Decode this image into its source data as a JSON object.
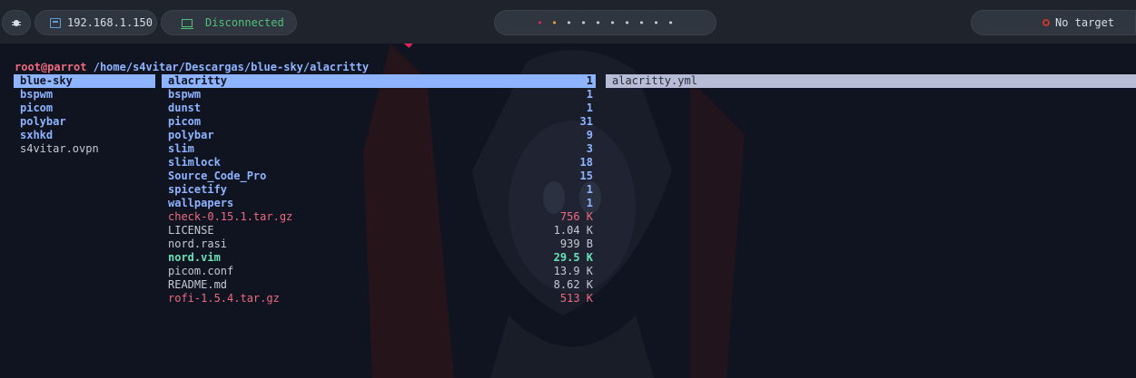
{
  "topbar": {
    "ip": "192.168.1.150",
    "vpn_status": "Disconnected",
    "workspaces": [
      "•",
      "•",
      "•",
      "•",
      "•",
      "•",
      "•",
      "•",
      "•",
      "•"
    ],
    "workspace_colors": [
      "#e0245e",
      "#f0a030",
      "#c8ccd4",
      "#c8ccd4",
      "#c8ccd4",
      "#c8ccd4",
      "#c8ccd4",
      "#c8ccd4",
      "#c8ccd4",
      "#c8ccd4"
    ],
    "target": "No target"
  },
  "ranger": {
    "path_user": "root@parrot",
    "path_dir": "/home/s4vitar/Descargas/blue-sky/alacritty",
    "parent": [
      {
        "name": "blue-sky",
        "type": "dir",
        "selected": true
      },
      {
        "name": "bspwm",
        "type": "dir"
      },
      {
        "name": "picom",
        "type": "dir"
      },
      {
        "name": "polybar",
        "type": "dir"
      },
      {
        "name": "sxhkd",
        "type": "dir"
      },
      {
        "name": "s4vitar.ovpn",
        "type": "file"
      }
    ],
    "current": [
      {
        "name": "alacritty",
        "size": "1",
        "type": "dir",
        "selected": true
      },
      {
        "name": "bspwm",
        "size": "1",
        "type": "dir"
      },
      {
        "name": "dunst",
        "size": "1",
        "type": "dir"
      },
      {
        "name": "picom",
        "size": "31",
        "type": "dir"
      },
      {
        "name": "polybar",
        "size": "9",
        "type": "dir"
      },
      {
        "name": "slim",
        "size": "3",
        "type": "dir"
      },
      {
        "name": "slimlock",
        "size": "18",
        "type": "dir"
      },
      {
        "name": "Source_Code_Pro",
        "size": "15",
        "type": "dir"
      },
      {
        "name": "spicetify",
        "size": "1",
        "type": "dir"
      },
      {
        "name": "wallpapers",
        "size": "1",
        "type": "dir"
      },
      {
        "name": "check-0.15.1.tar.gz",
        "size": "756 K",
        "type": "arch"
      },
      {
        "name": "LICENSE",
        "size": "1.04 K",
        "type": "file"
      },
      {
        "name": "nord.rasi",
        "size": "939 B",
        "type": "file"
      },
      {
        "name": "nord.vim",
        "size": "29.5 K",
        "type": "exec"
      },
      {
        "name": "picom.conf",
        "size": "13.9 K",
        "type": "file"
      },
      {
        "name": "README.md",
        "size": "8.62 K",
        "type": "file"
      },
      {
        "name": "rofi-1.5.4.tar.gz",
        "size": "513 K",
        "type": "arch"
      }
    ],
    "preview": [
      {
        "name": "alacritty.yml",
        "type": "file",
        "selected": true
      }
    ]
  }
}
